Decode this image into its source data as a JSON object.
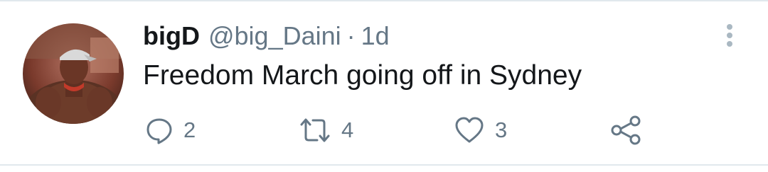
{
  "tweet": {
    "display_name": "bigD",
    "handle": "@big_Daini",
    "separator": "·",
    "time": "1d",
    "text": "Freedom March going off in Sydney",
    "avatar_icon": "user-avatar-photo",
    "more_icon": "vertical-ellipsis-icon"
  },
  "actions": {
    "reply": {
      "icon": "reply-icon",
      "count": "2"
    },
    "retweet": {
      "icon": "retweet-icon",
      "count": "4"
    },
    "like": {
      "icon": "heart-icon",
      "count": "3"
    },
    "share": {
      "icon": "share-icon"
    }
  },
  "colors": {
    "primary_text": "#14171a",
    "secondary_text": "#657786",
    "divider": "#e1e8ed"
  }
}
